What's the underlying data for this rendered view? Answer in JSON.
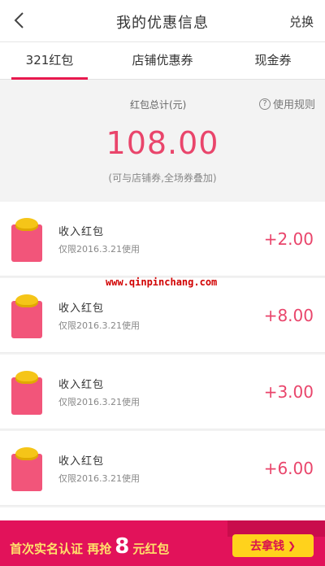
{
  "header": {
    "title": "我的优惠信息",
    "redeem_label": "兑换"
  },
  "tabs": [
    {
      "label": "321红包",
      "active": true
    },
    {
      "label": "店铺优惠券",
      "active": false
    },
    {
      "label": "现金券",
      "active": false
    }
  ],
  "summary": {
    "label": "红包总计(元)",
    "rules_label": "使用规则",
    "amount": "108.00",
    "note": "(可与店铺券,全场券叠加)"
  },
  "items": [
    {
      "title": "收入红包",
      "date": "仅限2016.3.21使用",
      "amount": "+2.00"
    },
    {
      "title": "收入红包",
      "date": "仅限2016.3.21使用",
      "amount": "+8.00"
    },
    {
      "title": "收入红包",
      "date": "仅限2016.3.21使用",
      "amount": "+3.00"
    },
    {
      "title": "收入红包",
      "date": "仅限2016.3.21使用",
      "amount": "+6.00"
    }
  ],
  "watermark": "www.qinpinchang.com",
  "banner": {
    "text_pre": "首次实名认证 再抢",
    "number": "8",
    "text_post": "元红包",
    "button_label": "去拿钱"
  },
  "colors": {
    "accent": "#e8194e",
    "amount": "#e9456b",
    "banner_bg": "#e2125a",
    "banner_button": "#ffd21c"
  }
}
